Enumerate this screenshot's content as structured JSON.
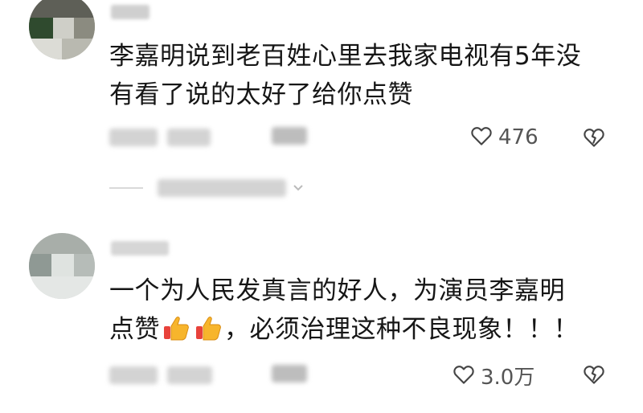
{
  "comments": [
    {
      "text_line1": "李嘉明说到老百姓心里去我家电视有5年没",
      "text_line2": "有看了说的太好了给你点赞",
      "likes": "476",
      "reply_toggle": true
    },
    {
      "text_line1": "一个为人民发真言的好人，为演员李嘉明",
      "text_line2_part1": "点赞",
      "text_line2_part2": "，必须治理这种不良现象！！！",
      "likes": "3.0万"
    }
  ],
  "icons": {
    "like": "heart-outline-icon",
    "dislike": "broken-heart-icon",
    "emoji": "thumbs-up-emoji"
  },
  "colors": {
    "text": "#161616",
    "meta": "#555555",
    "emoji_yellow": "#f7b52c",
    "emoji_red": "#e8423b"
  }
}
